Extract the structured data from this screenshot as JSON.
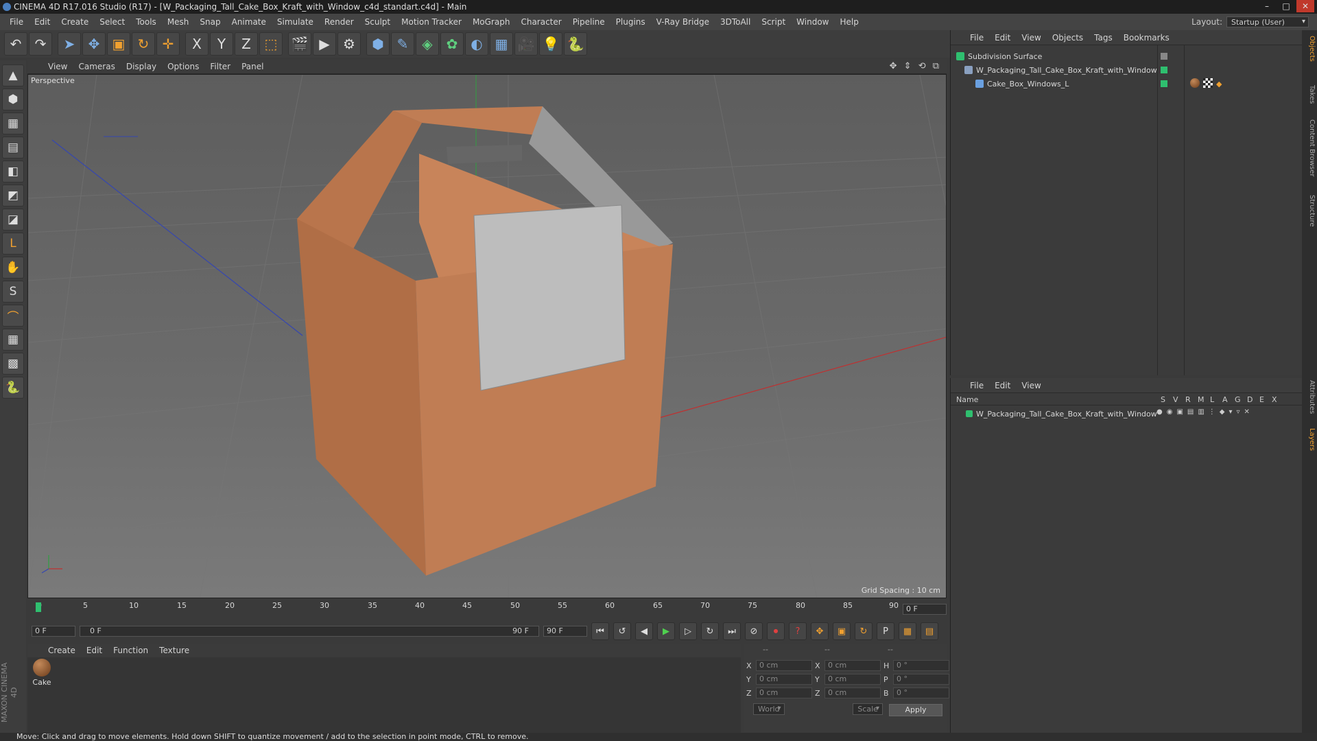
{
  "window": {
    "title": "CINEMA 4D R17.016 Studio (R17) - [W_Packaging_Tall_Cake_Box_Kraft_with_Window_c4d_standart.c4d] - Main",
    "min": "–",
    "max": "□",
    "close": "✕"
  },
  "menubar": {
    "items": [
      "File",
      "Edit",
      "Create",
      "Select",
      "Tools",
      "Mesh",
      "Snap",
      "Animate",
      "Simulate",
      "Render",
      "Sculpt",
      "Motion Tracker",
      "MoGraph",
      "Character",
      "Pipeline",
      "Plugins",
      "V-Ray Bridge",
      "3DToAll",
      "Script",
      "Window",
      "Help"
    ],
    "layout_label": "Layout:",
    "layout_value": "Startup (User)"
  },
  "toolbar": {
    "icons": [
      "undo-icon",
      "redo-icon",
      "select-arrow-icon",
      "move-icon",
      "scale-icon",
      "rotate-icon",
      "transform-icon",
      "x-axis-icon",
      "y-axis-icon",
      "z-axis-icon",
      "world-coords-icon",
      "render-view-icon",
      "render-picture-icon",
      "render-settings-icon",
      "cube-icon",
      "pen-icon",
      "subdivision-icon",
      "cloner-icon",
      "deformer-icon",
      "floor-icon",
      "camera-icon",
      "light-icon",
      "python-icon"
    ],
    "glyphs": [
      "↶",
      "↷",
      "➤",
      "✥",
      "▣",
      "↻",
      "✛",
      "X",
      "Y",
      "Z",
      "⬚",
      "🎬",
      "▶",
      "⚙",
      "⬢",
      "✎",
      "◈",
      "✿",
      "◐",
      "▦",
      "🎥",
      "💡",
      "🐍"
    ]
  },
  "lefttools": {
    "glyphs": [
      "▲",
      "⬢",
      "▦",
      "▤",
      "◧",
      "◩",
      "◪",
      "L",
      "✋",
      "S",
      "⌒",
      "▦",
      "▩",
      "🐍"
    ]
  },
  "viewport": {
    "menu": [
      "View",
      "Cameras",
      "Display",
      "Options",
      "Filter",
      "Panel"
    ],
    "nav": "✥ ⇕ ⟲ ⧉",
    "label": "Perspective",
    "grid_spacing": "Grid Spacing : 10 cm"
  },
  "timeline": {
    "ticks": [
      "0",
      "5",
      "10",
      "15",
      "20",
      "25",
      "30",
      "35",
      "40",
      "45",
      "50",
      "55",
      "60",
      "65",
      "70",
      "75",
      "80",
      "85",
      "90"
    ],
    "current_frame": "0 F"
  },
  "playbar": {
    "start": "0 F",
    "range_start": "0 F",
    "range_end": "90 F",
    "end": "90 F",
    "glyphs": [
      "⏮",
      "↺",
      "◀",
      "▶",
      "▷",
      "↻",
      "⏭",
      "⊘",
      "⏺",
      "?",
      "✥",
      "▣",
      "↻",
      "P",
      "▦",
      "▤"
    ]
  },
  "materials": {
    "menu": [
      "Create",
      "Edit",
      "Function",
      "Texture"
    ],
    "items": [
      {
        "name": "Cake"
      }
    ]
  },
  "coords": {
    "headers": [
      "--",
      "--",
      "--"
    ],
    "rows": [
      {
        "l1": "X",
        "v1": "0 cm",
        "l2": "X",
        "v2": "0 cm",
        "l3": "H",
        "v3": "0 °"
      },
      {
        "l1": "Y",
        "v1": "0 cm",
        "l2": "Y",
        "v2": "0 cm",
        "l3": "P",
        "v3": "0 °"
      },
      {
        "l1": "Z",
        "v1": "0 cm",
        "l2": "Z",
        "v2": "0 cm",
        "l3": "B",
        "v3": "0 °"
      }
    ],
    "mode1": "World",
    "mode2": "Scale",
    "apply": "Apply"
  },
  "objects": {
    "menu": [
      "File",
      "Edit",
      "View",
      "Objects",
      "Tags",
      "Bookmarks"
    ],
    "items": [
      {
        "name": "Subdivision Surface",
        "indent": 0
      },
      {
        "name": "W_Packaging_Tall_Cake_Box_Kraft_with_Window",
        "indent": 1
      },
      {
        "name": "Cake_Box_Windows_L",
        "indent": 2
      }
    ]
  },
  "layers": {
    "menu": [
      "File",
      "Edit",
      "View"
    ],
    "header_name": "Name",
    "header_cols": [
      "S",
      "V",
      "R",
      "M",
      "L",
      "A",
      "G",
      "D",
      "E",
      "X"
    ],
    "items": [
      {
        "name": "W_Packaging_Tall_Cake_Box_Kraft_with_Window"
      }
    ]
  },
  "righttabs": [
    "Objects",
    "Takes",
    "Content Browser",
    "Structure",
    "Attributes",
    "Layers"
  ],
  "status": "Move: Click and drag to move elements. Hold down SHIFT to quantize movement / add to the selection in point mode, CTRL to remove.",
  "brand": "MAXON CINEMA 4D"
}
